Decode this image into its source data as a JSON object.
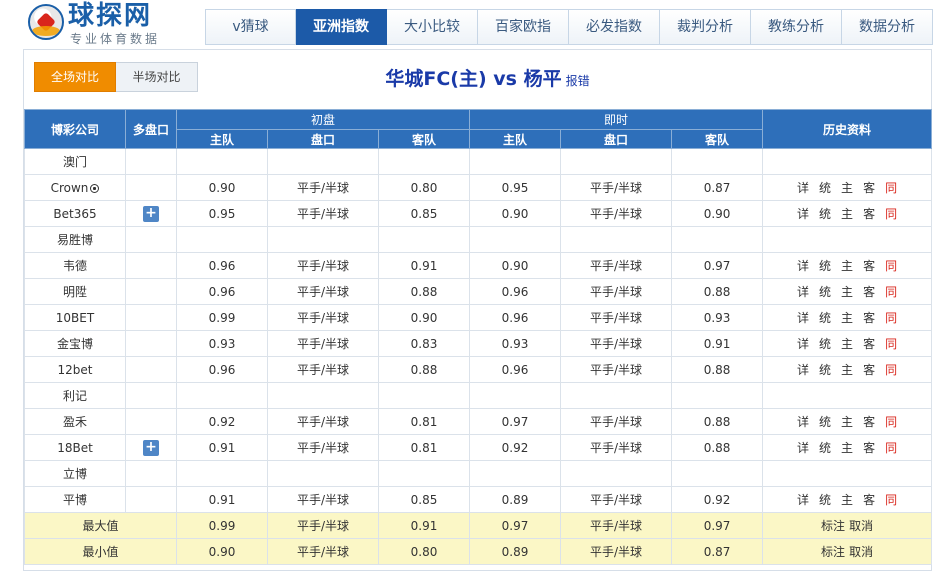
{
  "logo": {
    "title": "球探网",
    "subtitle": "专业体育数据"
  },
  "nav": {
    "tabs": [
      {
        "label": "v猜球",
        "active": false
      },
      {
        "label": "亚洲指数",
        "active": true
      },
      {
        "label": "大小比较",
        "active": false
      },
      {
        "label": "百家欧指",
        "active": false
      },
      {
        "label": "必发指数",
        "active": false
      },
      {
        "label": "裁判分析",
        "active": false
      },
      {
        "label": "教练分析",
        "active": false
      },
      {
        "label": "数据分析",
        "active": false
      }
    ]
  },
  "toggle": {
    "full": "全场对比",
    "half": "半场对比"
  },
  "match": {
    "title": "华城FC(主) vs 杨平",
    "report": "报错"
  },
  "table": {
    "headers": {
      "company": "博彩公司",
      "multi": "多盘口",
      "initial": "初盘",
      "live": "即时",
      "history": "历史资料",
      "home": "主队",
      "handicap": "盘口",
      "away": "客队"
    },
    "link_labels": [
      "详",
      "统",
      "主",
      "客",
      "同"
    ],
    "rows": [
      {
        "type": "group",
        "name": "澳门"
      },
      {
        "type": "data",
        "name": "Crown",
        "icon": "football-icon",
        "multi": false,
        "init": [
          "0.90",
          "平手/半球",
          "0.80"
        ],
        "live": [
          "0.95",
          "平手/半球",
          "0.87"
        ]
      },
      {
        "type": "data",
        "name": "Bet365",
        "multi": true,
        "init": [
          "0.95",
          "平手/半球",
          "0.85"
        ],
        "live": [
          "0.90",
          "平手/半球",
          "0.90"
        ]
      },
      {
        "type": "group",
        "name": "易胜博"
      },
      {
        "type": "data",
        "name": "韦德",
        "multi": false,
        "init": [
          "0.96",
          "平手/半球",
          "0.91"
        ],
        "live": [
          "0.90",
          "平手/半球",
          "0.97"
        ]
      },
      {
        "type": "data",
        "name": "明陞",
        "multi": false,
        "init": [
          "0.96",
          "平手/半球",
          "0.88"
        ],
        "live": [
          "0.96",
          "平手/半球",
          "0.88"
        ]
      },
      {
        "type": "data",
        "name": "10BET",
        "multi": false,
        "init": [
          "0.99",
          "平手/半球",
          "0.90"
        ],
        "live": [
          "0.96",
          "平手/半球",
          "0.93"
        ]
      },
      {
        "type": "data",
        "name": "金宝博",
        "multi": false,
        "init": [
          "0.93",
          "平手/半球",
          "0.83"
        ],
        "live": [
          "0.93",
          "平手/半球",
          "0.91"
        ]
      },
      {
        "type": "data",
        "name": "12bet",
        "multi": false,
        "init": [
          "0.96",
          "平手/半球",
          "0.88"
        ],
        "live": [
          "0.96",
          "平手/半球",
          "0.88"
        ]
      },
      {
        "type": "group",
        "name": "利记"
      },
      {
        "type": "data",
        "name": "盈禾",
        "multi": false,
        "init": [
          "0.92",
          "平手/半球",
          "0.81"
        ],
        "live": [
          "0.97",
          "平手/半球",
          "0.88"
        ]
      },
      {
        "type": "data",
        "name": "18Bet",
        "multi": true,
        "init": [
          "0.91",
          "平手/半球",
          "0.81"
        ],
        "live": [
          "0.92",
          "平手/半球",
          "0.88"
        ]
      },
      {
        "type": "group",
        "name": "立博"
      },
      {
        "type": "data",
        "name": "平博",
        "multi": false,
        "init": [
          "0.91",
          "平手/半球",
          "0.85"
        ],
        "live": [
          "0.89",
          "平手/半球",
          "0.92"
        ]
      }
    ],
    "stats": [
      {
        "name": "最大值",
        "init": [
          "0.99",
          "平手/半球",
          "0.91"
        ],
        "live": [
          "0.97",
          "平手/半球",
          "0.97"
        ],
        "links": [
          "标注",
          "取消"
        ]
      },
      {
        "name": "最小值",
        "init": [
          "0.90",
          "平手/半球",
          "0.80"
        ],
        "live": [
          "0.89",
          "平手/半球",
          "0.87"
        ],
        "links": [
          "标注",
          "取消"
        ]
      }
    ]
  }
}
